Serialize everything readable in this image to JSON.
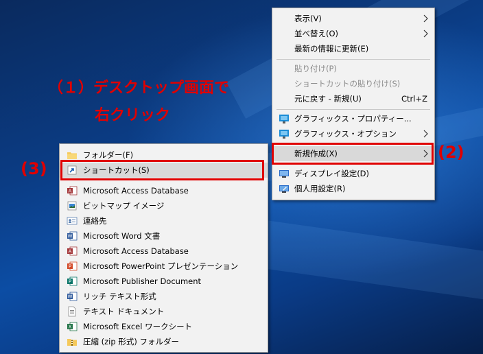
{
  "annotations": {
    "step1_line1": "（１）デスクトップ画面で",
    "step1_line2": "右クリック",
    "step2": "(2)",
    "step3": "(3)"
  },
  "context_menu": {
    "items": [
      {
        "label": "表示(V)",
        "submenu": true
      },
      {
        "label": "並べ替え(O)",
        "submenu": true
      },
      {
        "label": "最新の情報に更新(E)"
      },
      {
        "label": "貼り付け(P)",
        "disabled": true
      },
      {
        "label": "ショートカットの貼り付け(S)",
        "disabled": true
      },
      {
        "label": "元に戻す - 新規(U)",
        "shortcut": "Ctrl+Z"
      },
      {
        "label": "グラフィックス・プロパティー...",
        "icon": "graphics-properties-icon"
      },
      {
        "label": "グラフィックス・オプション",
        "icon": "graphics-options-icon",
        "submenu": true
      },
      {
        "label": "新規作成(X)",
        "submenu": true,
        "highlighted": true
      },
      {
        "label": "ディスプレイ設定(D)",
        "icon": "display-settings-icon"
      },
      {
        "label": "個人用設定(R)",
        "icon": "personalize-icon"
      }
    ]
  },
  "new_submenu": {
    "items": [
      {
        "label": "フォルダー(F)",
        "icon": "folder-icon"
      },
      {
        "label": "ショートカット(S)",
        "icon": "shortcut-icon",
        "highlighted": true
      },
      {
        "label": "Microsoft Access Database",
        "icon": "access-icon"
      },
      {
        "label": "ビットマップ イメージ",
        "icon": "bitmap-icon"
      },
      {
        "label": "連絡先",
        "icon": "contact-icon"
      },
      {
        "label": "Microsoft Word 文書",
        "icon": "word-icon"
      },
      {
        "label": "Microsoft Access Database",
        "icon": "access-icon"
      },
      {
        "label": "Microsoft PowerPoint プレゼンテーション",
        "icon": "powerpoint-icon"
      },
      {
        "label": "Microsoft Publisher Document",
        "icon": "publisher-icon"
      },
      {
        "label": "リッチ テキスト形式",
        "icon": "rtf-icon"
      },
      {
        "label": "テキスト ドキュメント",
        "icon": "text-document-icon"
      },
      {
        "label": "Microsoft Excel ワークシート",
        "icon": "excel-icon"
      },
      {
        "label": "圧縮 (zip 形式) フォルダー",
        "icon": "zip-folder-icon"
      }
    ]
  },
  "colors": {
    "annotation_red": "#e00000",
    "menu_bg": "#f2f2f2",
    "highlight": "#d9d9d9"
  }
}
